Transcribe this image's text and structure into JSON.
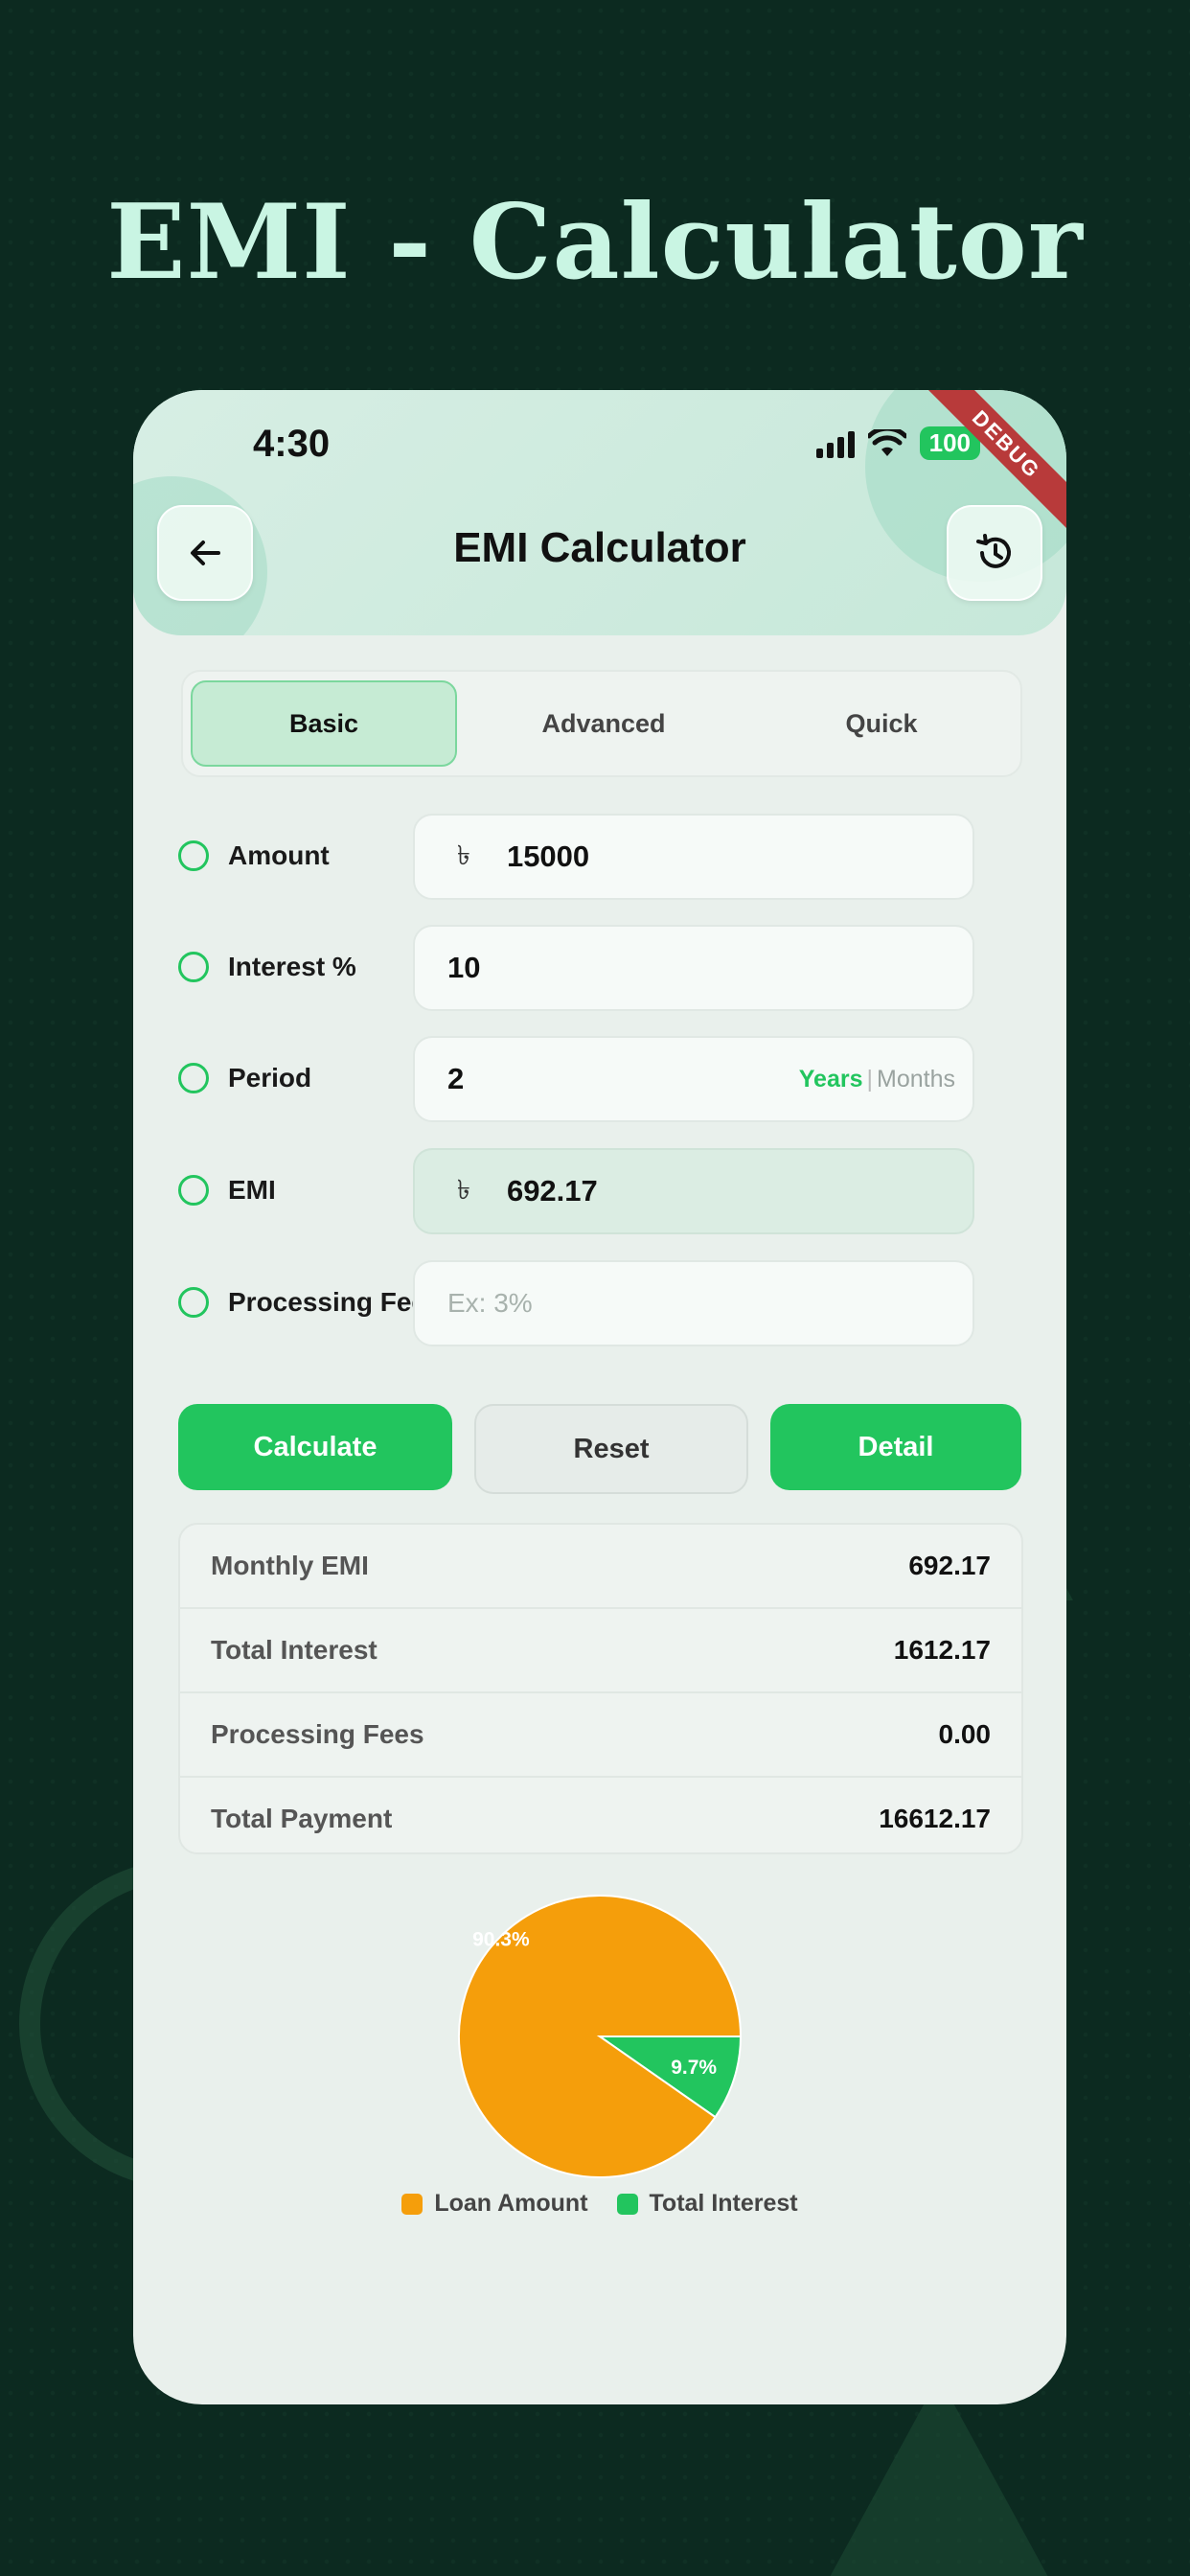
{
  "headline": "EMI - Calculator",
  "status": {
    "time": "4:30",
    "battery": "100",
    "debug": "DEBUG"
  },
  "appbar": {
    "title": "EMI Calculator"
  },
  "tabs": [
    {
      "label": "Basic",
      "active": true
    },
    {
      "label": "Advanced",
      "active": false
    },
    {
      "label": "Quick",
      "active": false
    }
  ],
  "form": {
    "amount": {
      "label": "Amount",
      "currency": "৳",
      "value": "15000"
    },
    "interest": {
      "label": "Interest %",
      "value": "10"
    },
    "period": {
      "label": "Period",
      "value": "2",
      "unit_selected": "Years",
      "unit_separator": "|",
      "unit_other": "Months"
    },
    "emi": {
      "label": "EMI",
      "currency": "৳",
      "value": "692.17"
    },
    "processing_fee": {
      "label": "Processing Fee %",
      "placeholder": "Ex: 3%"
    }
  },
  "buttons": {
    "calculate": "Calculate",
    "reset": "Reset",
    "detail": "Detail"
  },
  "results": [
    {
      "label": "Monthly EMI",
      "value": "692.17"
    },
    {
      "label": "Total Interest",
      "value": "1612.17"
    },
    {
      "label": "Processing Fees",
      "value": "0.00"
    },
    {
      "label": "Total Payment",
      "value": "16612.17"
    }
  ],
  "chart_data": {
    "type": "pie",
    "series": [
      {
        "name": "Loan Amount",
        "value": 90.3,
        "label": "90.3%",
        "color": "#f59e0b"
      },
      {
        "name": "Total Interest",
        "value": 9.7,
        "label": "9.7%",
        "color": "#22c55e"
      }
    ],
    "legend_position": "bottom"
  },
  "colors": {
    "accent": "#22c55e",
    "loan": "#f59e0b",
    "background": "#0c2a20"
  }
}
